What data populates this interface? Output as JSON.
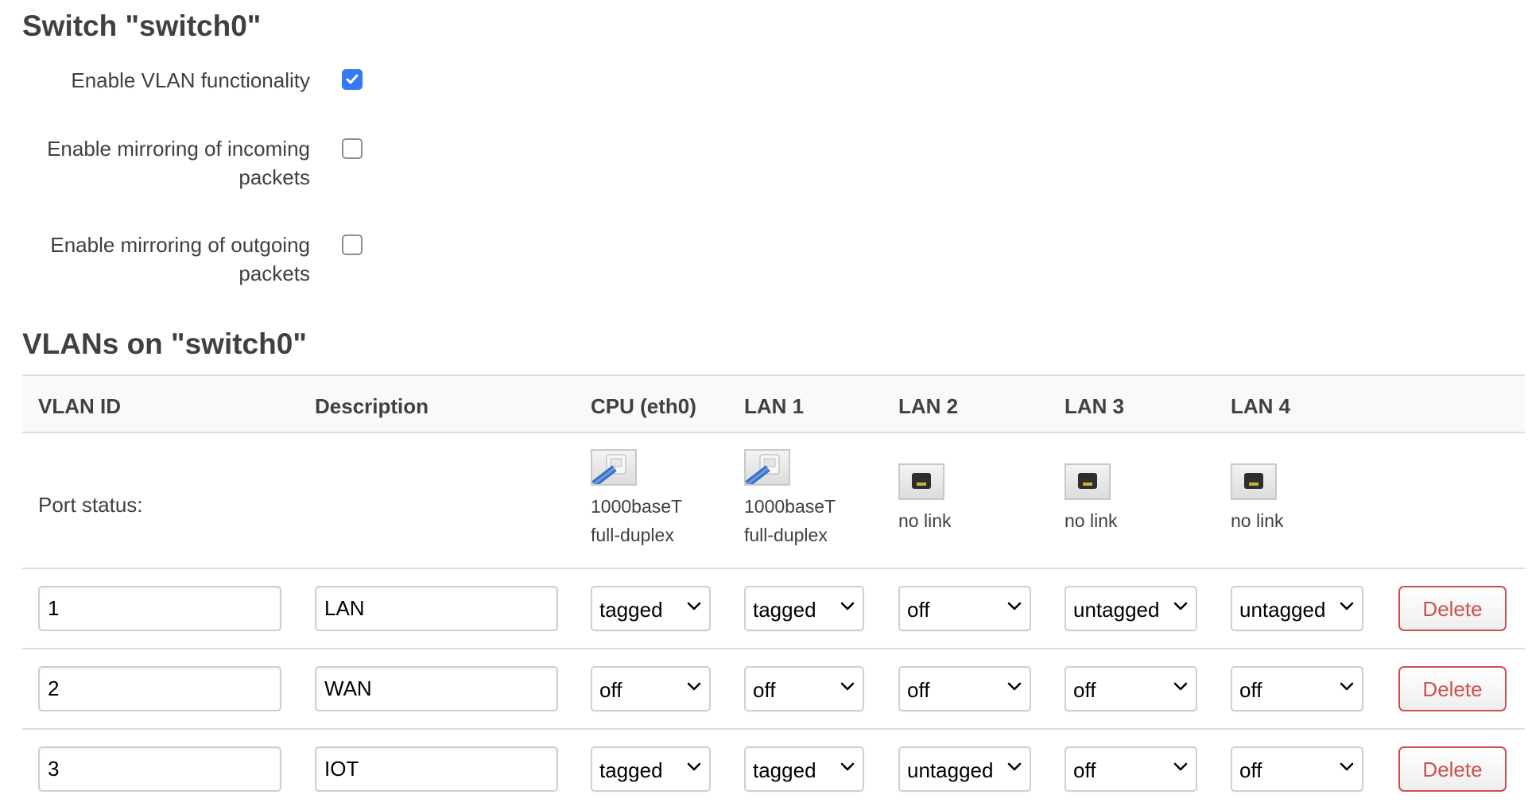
{
  "switch_section": {
    "title": "Switch \"switch0\"",
    "options": [
      {
        "label_line1": "Enable VLAN functionality",
        "label_line2": "",
        "checked": true
      },
      {
        "label_line1": "Enable mirroring of incoming",
        "label_line2": "packets",
        "checked": false
      },
      {
        "label_line1": "Enable mirroring of outgoing",
        "label_line2": "packets",
        "checked": false
      }
    ]
  },
  "vlan_section": {
    "title": "VLANs on \"switch0\"",
    "headers": [
      "VLAN ID",
      "Description",
      "CPU (eth0)",
      "LAN 1",
      "LAN 2",
      "LAN 3",
      "LAN 4"
    ],
    "port_status_label": "Port status:",
    "ports": [
      {
        "icon": "ethernet-connected-icon",
        "line1": "1000baseT",
        "line2": "full-duplex",
        "linked": true
      },
      {
        "icon": "ethernet-connected-icon",
        "line1": "1000baseT",
        "line2": "full-duplex",
        "linked": true
      },
      {
        "icon": "ethernet-disconnected-icon",
        "line1": "no link",
        "line2": "",
        "linked": false
      },
      {
        "icon": "ethernet-disconnected-icon",
        "line1": "no link",
        "line2": "",
        "linked": false
      },
      {
        "icon": "ethernet-disconnected-icon",
        "line1": "no link",
        "line2": "",
        "linked": false
      }
    ],
    "rows": [
      {
        "vlan_id": "1",
        "description": "LAN",
        "ports": [
          "tagged",
          "tagged",
          "off",
          "untagged",
          "untagged"
        ],
        "delete_label": "Delete"
      },
      {
        "vlan_id": "2",
        "description": "WAN",
        "ports": [
          "off",
          "off",
          "off",
          "off",
          "off"
        ],
        "delete_label": "Delete"
      },
      {
        "vlan_id": "3",
        "description": "IOT",
        "ports": [
          "tagged",
          "tagged",
          "untagged",
          "off",
          "off"
        ],
        "delete_label": "Delete"
      }
    ]
  },
  "colors": {
    "checkbox_accent": "#3478f6",
    "delete_accent": "#c9524e",
    "header_bg": "#f9f9f9"
  }
}
